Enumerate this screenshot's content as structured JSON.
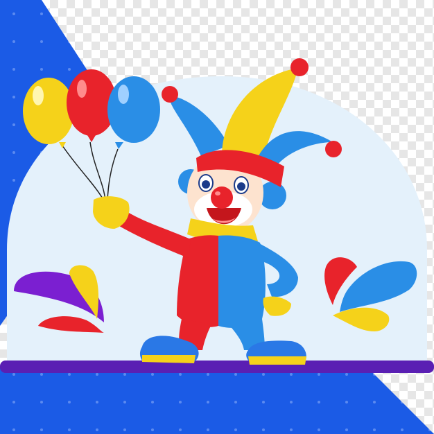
{
  "colors": {
    "checker_light": "#ffffff",
    "checker_dark": "#e6e6e6",
    "blue_bg": "#1b5be6",
    "dome": "#e4f1fb",
    "floor": "#5a1fb3",
    "red": "#e8232b",
    "yellow": "#f5d21a",
    "blue": "#2a8ee6",
    "purple": "#7b1fd1",
    "skin": "#fde3cf",
    "hair": "#2a8ee6",
    "shoe_blue": "#2a78e6"
  },
  "icons": [
    "clown-figure",
    "balloon-red",
    "balloon-yellow",
    "balloon-blue",
    "splash-left",
    "splash-right"
  ]
}
